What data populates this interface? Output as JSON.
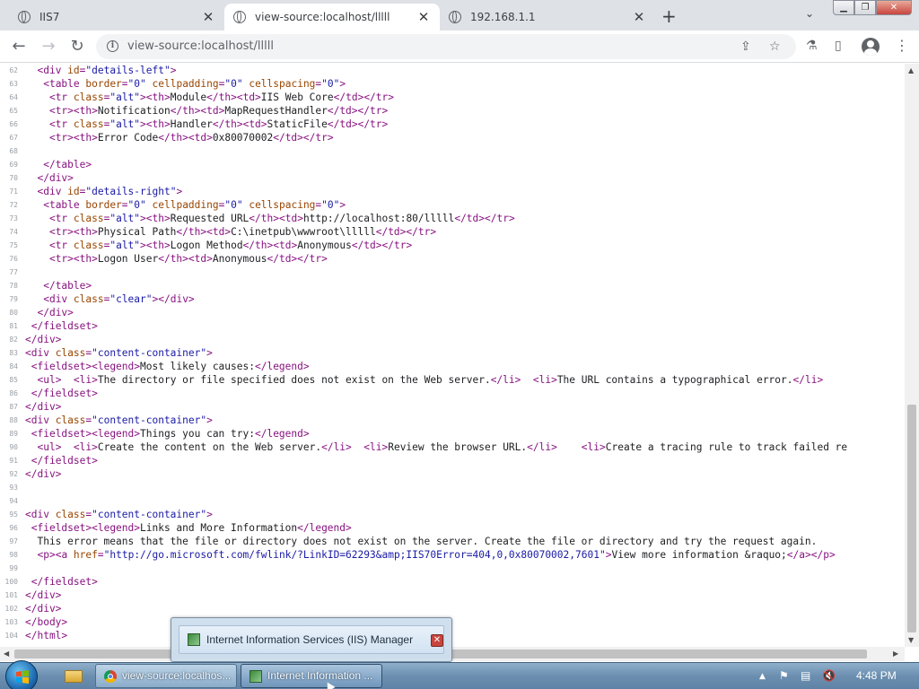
{
  "browser": {
    "tabs": [
      {
        "title": "IIS7",
        "active": false
      },
      {
        "title": "view-source:localhost/lllll",
        "active": true
      },
      {
        "title": "192.168.1.1",
        "active": false
      }
    ],
    "new_tab": "+",
    "tab_list": "⌄",
    "close_glyph": "✕",
    "window_controls": {
      "minimize": "▁",
      "maximize": "❐",
      "close": "✕"
    },
    "address": "view-source:localhost/lllll",
    "nav": {
      "back": "←",
      "forward": "→",
      "reload": "↻"
    },
    "icons": {
      "share": "⇪",
      "star": "☆",
      "extensions": "⚗",
      "sidepanel": "▯",
      "menu": "⋮"
    }
  },
  "source_lines": [
    {
      "n": "62",
      "t": "  <div id=\"details-left\">"
    },
    {
      "n": "63",
      "t": "   <table border=\"0\" cellpadding=\"0\" cellspacing=\"0\">"
    },
    {
      "n": "64",
      "t": "    <tr class=\"alt\"><th>Module</th><td>IIS Web Core</td></tr>"
    },
    {
      "n": "65",
      "t": "    <tr><th>Notification</th><td>MapRequestHandler</td></tr>"
    },
    {
      "n": "66",
      "t": "    <tr class=\"alt\"><th>Handler</th><td>StaticFile</td></tr>"
    },
    {
      "n": "67",
      "t": "    <tr><th>Error Code</th><td>0x80070002</td></tr>"
    },
    {
      "n": "68",
      "t": ""
    },
    {
      "n": "69",
      "t": "   </table>"
    },
    {
      "n": "70",
      "t": "  </div>"
    },
    {
      "n": "71",
      "t": "  <div id=\"details-right\">"
    },
    {
      "n": "72",
      "t": "   <table border=\"0\" cellpadding=\"0\" cellspacing=\"0\">"
    },
    {
      "n": "73",
      "t": "    <tr class=\"alt\"><th>Requested URL</th><td>http://localhost:80/lllll</td></tr>"
    },
    {
      "n": "74",
      "t": "    <tr><th>Physical Path</th><td>C:\\inetpub\\wwwroot\\lllll</td></tr>"
    },
    {
      "n": "75",
      "t": "    <tr class=\"alt\"><th>Logon Method</th><td>Anonymous</td></tr>"
    },
    {
      "n": "76",
      "t": "    <tr><th>Logon User</th><td>Anonymous</td></tr>"
    },
    {
      "n": "77",
      "t": ""
    },
    {
      "n": "78",
      "t": "   </table>"
    },
    {
      "n": "79",
      "t": "   <div class=\"clear\"></div>"
    },
    {
      "n": "80",
      "t": "  </div>"
    },
    {
      "n": "81",
      "t": " </fieldset>"
    },
    {
      "n": "82",
      "t": "</div>"
    },
    {
      "n": "83",
      "t": "<div class=\"content-container\">"
    },
    {
      "n": "84",
      "t": " <fieldset><legend>Most likely causes:</legend>"
    },
    {
      "n": "85",
      "t": "  <ul>  <li>The directory or file specified does not exist on the Web server.</li>  <li>The URL contains a typographical error.</li>"
    },
    {
      "n": "86",
      "t": " </fieldset>"
    },
    {
      "n": "87",
      "t": "</div>"
    },
    {
      "n": "88",
      "t": "<div class=\"content-container\">"
    },
    {
      "n": "89",
      "t": " <fieldset><legend>Things you can try:</legend>"
    },
    {
      "n": "90",
      "t": "  <ul>  <li>Create the content on the Web server.</li>  <li>Review the browser URL.</li>    <li>Create a tracing rule to track failed re"
    },
    {
      "n": "91",
      "t": " </fieldset>"
    },
    {
      "n": "92",
      "t": "</div>"
    },
    {
      "n": "93",
      "t": ""
    },
    {
      "n": "94",
      "t": ""
    },
    {
      "n": "95",
      "t": "<div class=\"content-container\">"
    },
    {
      "n": "96",
      "t": " <fieldset><legend>Links and More Information</legend>"
    },
    {
      "n": "97",
      "t": "  This error means that the file or directory does not exist on the server. Create the file or directory and try the request again."
    },
    {
      "n": "98",
      "t": "  <p><a href=\"http://go.microsoft.com/fwlink/?LinkID=62293&amp;IIS70Error=404,0,0x80070002,7601\">View more information &raquo;</a></p>"
    },
    {
      "n": "99",
      "t": ""
    },
    {
      "n": "100",
      "t": " </fieldset>"
    },
    {
      "n": "101",
      "t": "</div>"
    },
    {
      "n": "102",
      "t": "</div>"
    },
    {
      "n": "103",
      "t": "</body>"
    },
    {
      "n": "104",
      "t": "</html>"
    }
  ],
  "preview": {
    "title": "Internet Information Services (IIS) Manager",
    "close": "✕"
  },
  "taskbar": {
    "items": [
      {
        "label": "view-source:localhos..."
      },
      {
        "label": "Internet Information ..."
      }
    ],
    "clock": "4:48 PM",
    "tray": {
      "expand": "▲",
      "flag": "⚑",
      "network": "▤",
      "volume": "🔇"
    }
  }
}
